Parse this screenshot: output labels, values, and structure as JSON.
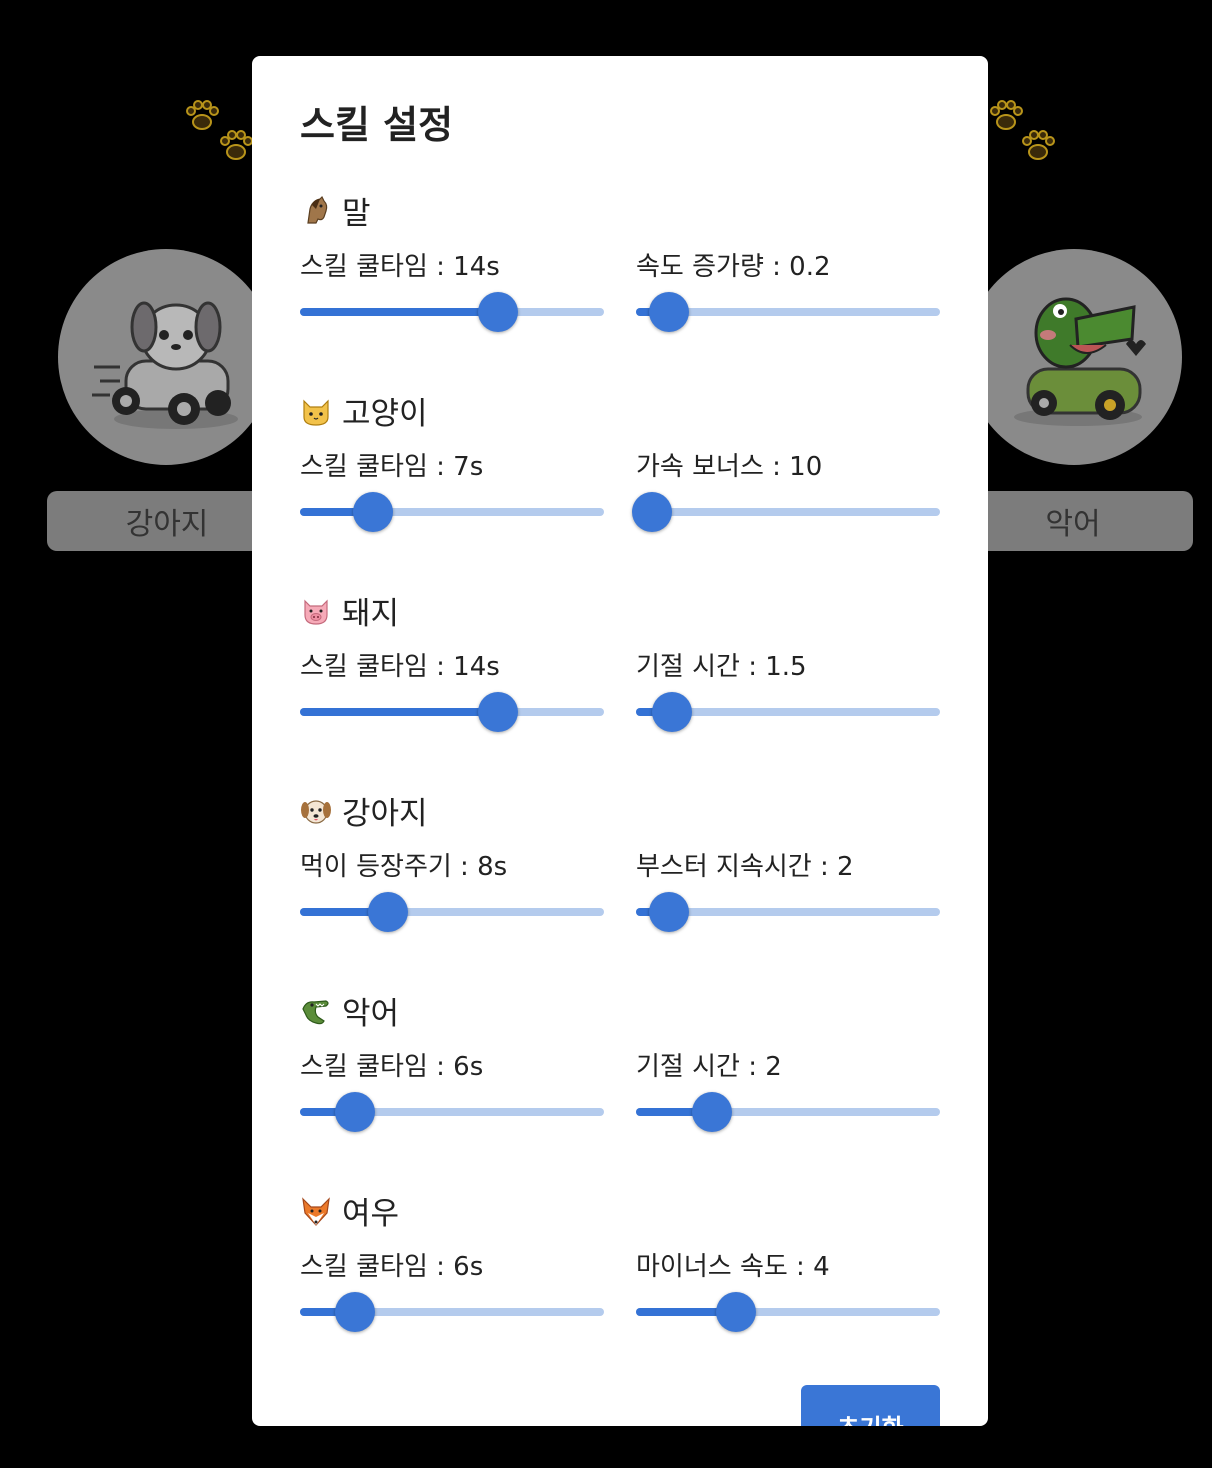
{
  "background": {
    "characters": [
      {
        "name": "강아지"
      },
      {
        "name": "악어"
      }
    ]
  },
  "modal": {
    "title": "스킬 설정",
    "sections": [
      {
        "name": "말",
        "icon": "horse-face-icon",
        "sliders": [
          {
            "label": "스킬 쿨타임 : 14s",
            "value": 14,
            "fill_fraction": 0.65
          },
          {
            "label": "속도 증가량 : 0.2",
            "value": 0.2,
            "fill_fraction": 0.11
          }
        ]
      },
      {
        "name": "고양이",
        "icon": "cat-face-icon",
        "sliders": [
          {
            "label": "스킬 쿨타임 : 7s",
            "value": 7,
            "fill_fraction": 0.24
          },
          {
            "label": "가속 보너스 : 10",
            "value": 10,
            "fill_fraction": 0.0
          }
        ]
      },
      {
        "name": "돼지",
        "icon": "pig-face-icon",
        "sliders": [
          {
            "label": "스킬 쿨타임 : 14s",
            "value": 14,
            "fill_fraction": 0.65
          },
          {
            "label": "기절 시간 : 1.5",
            "value": 1.5,
            "fill_fraction": 0.12
          }
        ]
      },
      {
        "name": "강아지",
        "icon": "dog-face-icon",
        "sliders": [
          {
            "label": "먹이 등장주기 : 8s",
            "value": 8,
            "fill_fraction": 0.29
          },
          {
            "label": "부스터 지속시간 : 2",
            "value": 2,
            "fill_fraction": 0.11
          }
        ]
      },
      {
        "name": "악어",
        "icon": "crocodile-icon",
        "sliders": [
          {
            "label": "스킬 쿨타임 : 6s",
            "value": 6,
            "fill_fraction": 0.18
          },
          {
            "label": "기절 시간 : 2",
            "value": 2,
            "fill_fraction": 0.25
          }
        ]
      },
      {
        "name": "여우",
        "icon": "fox-face-icon",
        "sliders": [
          {
            "label": "스킬 쿨타임 : 6s",
            "value": 6,
            "fill_fraction": 0.18
          },
          {
            "label": "마이너스 속도 : 4",
            "value": 4,
            "fill_fraction": 0.33
          }
        ]
      }
    ],
    "reset_label": "초기화"
  },
  "colors": {
    "accent": "#3a76d6",
    "track": "#b4cbed",
    "overlay": "#000000"
  }
}
